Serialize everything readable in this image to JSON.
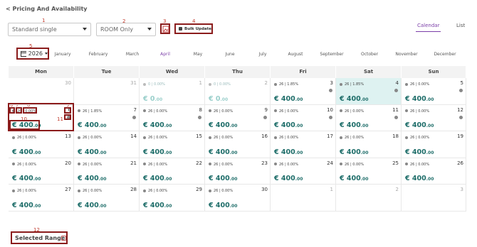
{
  "header": {
    "back_label": "< Pricing And Availability"
  },
  "filters": {
    "room": "Standard single",
    "rate_plan": "ROOM Only",
    "bulk_update_label": "Bulk Update"
  },
  "view_tabs": [
    "Calendar",
    "List"
  ],
  "year": "2026",
  "months": [
    "January",
    "February",
    "March",
    "April",
    "May",
    "June",
    "July",
    "August",
    "September",
    "October",
    "November",
    "December"
  ],
  "weekdays": [
    "Mon",
    "Tue",
    "Wed",
    "Thu",
    "Fri",
    "Sat",
    "Sun"
  ],
  "annotations": [
    "1",
    "2",
    "3",
    "4",
    "5",
    "6",
    "7",
    "8",
    "9",
    "10",
    "11",
    "12"
  ],
  "weeks": [
    [
      {
        "day": "30",
        "dim": true,
        "stat": "",
        "price": "",
        "dec": ""
      },
      {
        "day": "31",
        "dim": true,
        "stat": "",
        "price": "",
        "dec": ""
      },
      {
        "day": "1",
        "dim": true,
        "stat": "0 | 0.00%",
        "price": "€ 0",
        "dec": ".00"
      },
      {
        "day": "2",
        "dim": true,
        "stat": "0 | 0.00%",
        "price": "€ 0",
        "dec": ".00"
      },
      {
        "day": "3",
        "stat": "26 | 1.85%",
        "price": "€ 400",
        "dec": ".00",
        "gear": true
      },
      {
        "day": "4",
        "stat": "26 | 1.85%",
        "price": "€ 400",
        "dec": ".00",
        "gear": true,
        "hi": true
      },
      {
        "day": "5",
        "stat": "26 | 0.00%",
        "price": "€ 400",
        "dec": ".00",
        "gear": true
      }
    ],
    [
      {
        "day": "6",
        "stat": "26 | 0.00%",
        "price": "€ 400",
        "dec": ".00",
        "gear": true
      },
      {
        "day": "7",
        "stat": "26 | 1.85%",
        "price": "€ 400",
        "dec": ".00",
        "gear": true
      },
      {
        "day": "8",
        "stat": "26 | 0.00%",
        "price": "€ 400",
        "dec": ".00",
        "gear": true
      },
      {
        "day": "9",
        "stat": "26 | 0.00%",
        "price": "€ 400",
        "dec": ".00",
        "gear": true
      },
      {
        "day": "10",
        "stat": "26 | 0.00%",
        "price": "€ 400",
        "dec": ".00",
        "gear": true
      },
      {
        "day": "11",
        "stat": "26 | 0.00%",
        "price": "€ 400",
        "dec": ".00",
        "gear": true
      },
      {
        "day": "12",
        "stat": "26 | 0.00%",
        "price": "€ 400",
        "dec": ".00",
        "gear": true
      }
    ],
    [
      {
        "day": "13",
        "stat": "26 | 0.00%",
        "price": "€ 400",
        "dec": ".00"
      },
      {
        "day": "14",
        "stat": "26 | 0.00%",
        "price": "€ 400",
        "dec": ".00"
      },
      {
        "day": "15",
        "stat": "26 | 0.00%",
        "price": "€ 400",
        "dec": ".00"
      },
      {
        "day": "16",
        "stat": "26 | 0.00%",
        "price": "€ 400",
        "dec": ".00"
      },
      {
        "day": "17",
        "stat": "26 | 0.00%",
        "price": "€ 400",
        "dec": ".00"
      },
      {
        "day": "18",
        "stat": "26 | 0.00%",
        "price": "€ 400",
        "dec": ".00"
      },
      {
        "day": "19",
        "stat": "26 | 0.00%",
        "price": "€ 400",
        "dec": ".00"
      }
    ],
    [
      {
        "day": "20",
        "stat": "26 | 0.00%",
        "price": "€ 400",
        "dec": ".00"
      },
      {
        "day": "21",
        "stat": "26 | 0.00%",
        "price": "€ 400",
        "dec": ".00"
      },
      {
        "day": "22",
        "stat": "26 | 0.00%",
        "price": "€ 400",
        "dec": ".00"
      },
      {
        "day": "23",
        "stat": "26 | 0.00%",
        "price": "€ 400",
        "dec": ".00"
      },
      {
        "day": "24",
        "stat": "26 | 0.00%",
        "price": "€ 400",
        "dec": ".00"
      },
      {
        "day": "25",
        "stat": "26 | 0.00%",
        "price": "€ 400",
        "dec": ".00"
      },
      {
        "day": "26",
        "stat": "26 | 0.00%",
        "price": "€ 400",
        "dec": ".00"
      }
    ],
    [
      {
        "day": "27",
        "stat": "26 | 0.00%",
        "price": "€ 400",
        "dec": ".00"
      },
      {
        "day": "28",
        "stat": "26 | 0.00%",
        "price": "€ 400",
        "dec": ".00"
      },
      {
        "day": "29",
        "stat": "26 | 0.00%",
        "price": "€ 400",
        "dec": ".00"
      },
      {
        "day": "30",
        "stat": "26 | 0.00%",
        "price": "€ 400",
        "dec": ".00"
      },
      {
        "day": "1",
        "dim": true,
        "stat": "",
        "price": "",
        "dec": ""
      },
      {
        "day": "2",
        "dim": true,
        "stat": "",
        "price": "",
        "dec": ""
      },
      {
        "day": "3",
        "dim": true,
        "stat": "",
        "price": "",
        "dec": ""
      }
    ]
  ],
  "selected_range_label": "Selected Range:",
  "colors": {
    "accent": "#7b3ea8",
    "price": "#1f6e6a",
    "highlight": "#def2f1",
    "annotation": "#8b1c1c"
  }
}
